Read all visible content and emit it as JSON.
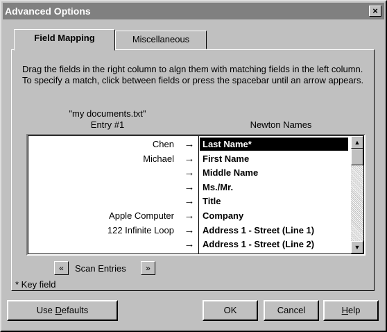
{
  "window": {
    "title": "Advanced Options",
    "close": "×"
  },
  "tabs": [
    {
      "label": "Field Mapping",
      "active": true
    },
    {
      "label": "Miscellaneous",
      "active": false
    }
  ],
  "instructions": "Drag the fields in the right column to algn them with matching fields in the left column.  To specify a match, click between fields or press the spacebar until an arrow appears.",
  "source_header": {
    "filename": "\"my documents.txt\"",
    "entry": "Entry #1"
  },
  "target_header": "Newton Names",
  "mapping_rows": [
    {
      "entry": "Chen",
      "arrow": "→",
      "field": "Last Name*",
      "selected": true
    },
    {
      "entry": "Michael",
      "arrow": "→",
      "field": "First Name"
    },
    {
      "entry": "",
      "arrow": "→",
      "field": "Middle Name"
    },
    {
      "entry": "",
      "arrow": "→",
      "field": "Ms./Mr."
    },
    {
      "entry": "",
      "arrow": "→",
      "field": "Title"
    },
    {
      "entry": "Apple Computer",
      "arrow": "→",
      "field": "Company"
    },
    {
      "entry": "122 Infinite Loop",
      "arrow": "→",
      "field": "Address 1 - Street (Line 1)"
    },
    {
      "entry": "",
      "arrow": "→",
      "field": "Address 1 - Street (Line 2)"
    }
  ],
  "scan": {
    "prev": "«",
    "label": "Scan Entries",
    "next": "»"
  },
  "key_note": "* Key field",
  "buttons": {
    "use_defaults": {
      "pre": "Use ",
      "ul": "D",
      "post": "efaults"
    },
    "ok": "OK",
    "cancel": "Cancel",
    "help": {
      "ul": "H",
      "post": "elp"
    }
  }
}
